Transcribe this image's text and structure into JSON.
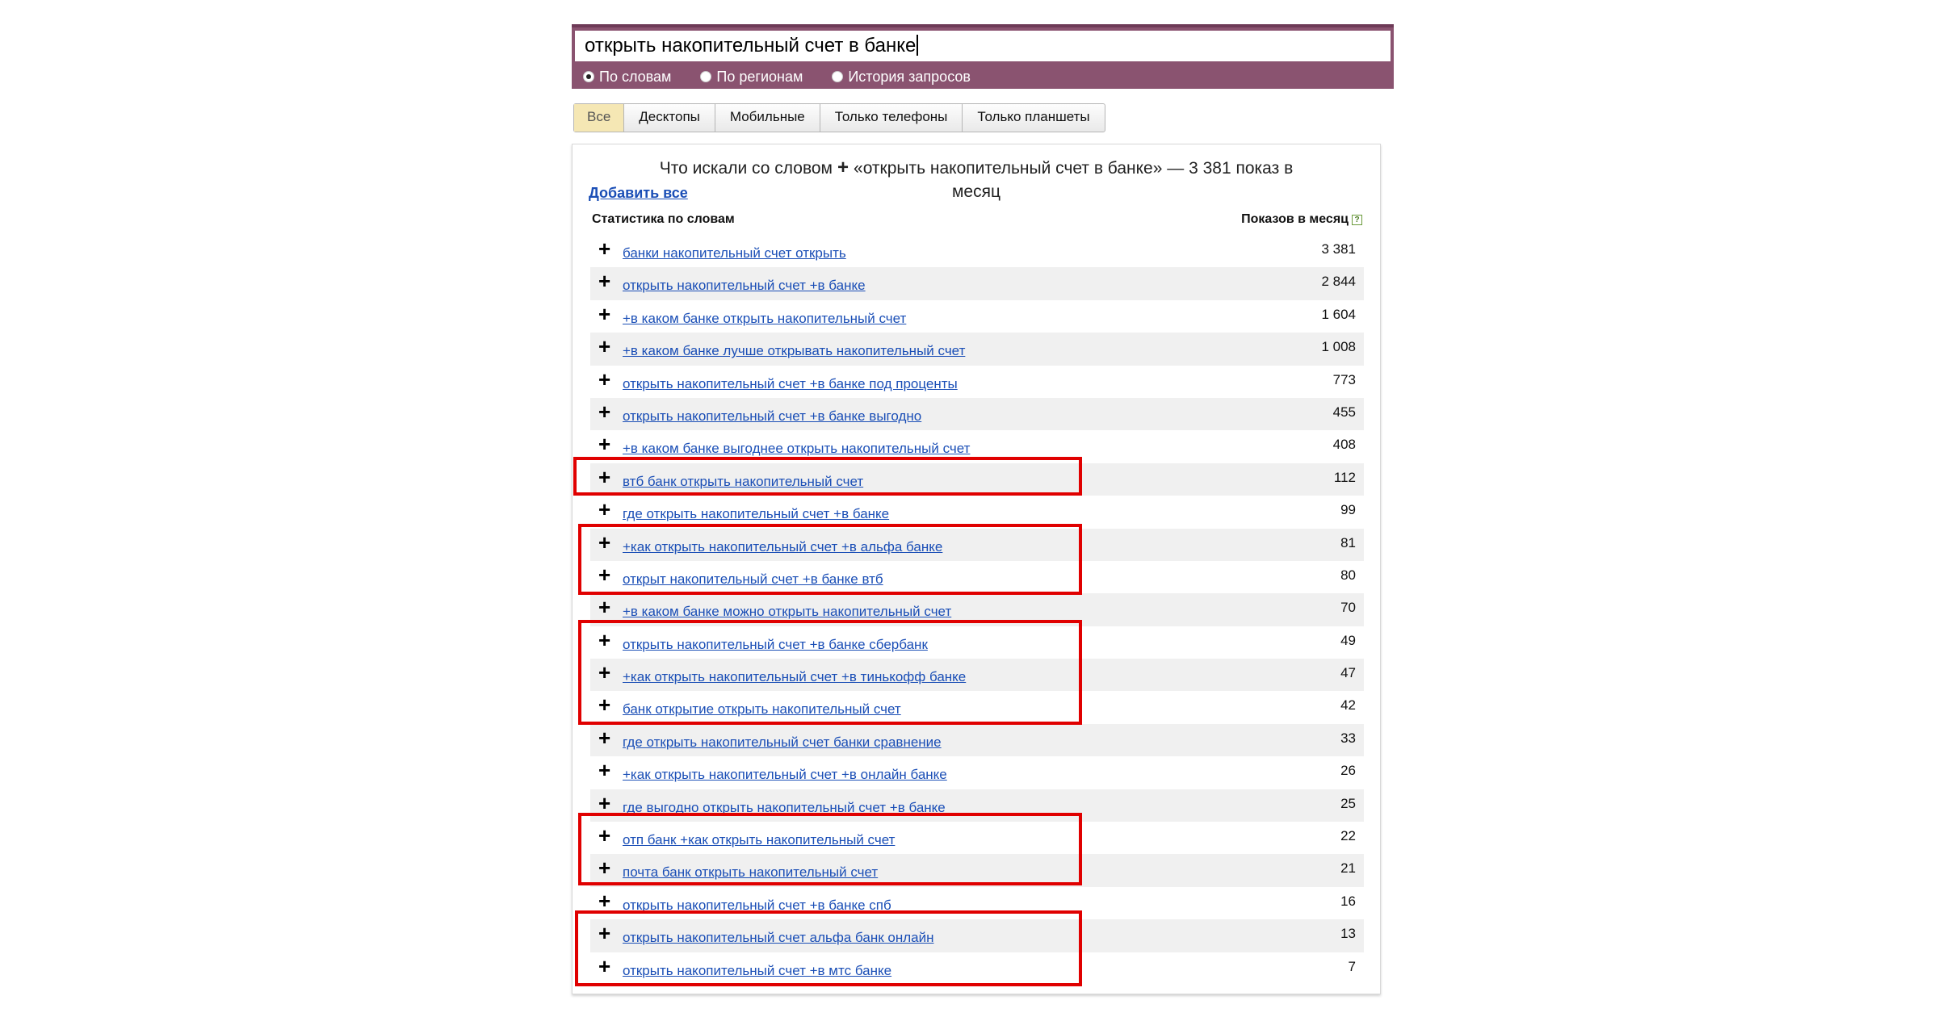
{
  "search": {
    "query": "открыть накопительный счет в банке",
    "modes": [
      {
        "label": "По словам",
        "checked": true
      },
      {
        "label": "По регионам",
        "checked": false
      },
      {
        "label": "История запросов",
        "checked": false
      }
    ]
  },
  "tabs": [
    {
      "label": "Все",
      "active": true
    },
    {
      "label": "Десктопы",
      "active": false
    },
    {
      "label": "Мобильные",
      "active": false
    },
    {
      "label": "Только телефоны",
      "active": false
    },
    {
      "label": "Только планшеты",
      "active": false
    }
  ],
  "stats": {
    "heading_prefix": "Что искали со словом",
    "heading_plus": "+",
    "heading_line1": "«открыть накопительный счет в банке» — 3 381 показ в",
    "heading_line2": "месяц",
    "add_all": "Добавить все",
    "col_words": "Статистика по словам",
    "col_shows": "Показов в месяц",
    "help_glyph": "?",
    "rows": [
      {
        "phrase": "банки накопительный счет открыть",
        "count": "3 381"
      },
      {
        "phrase": "открыть накопительный счет +в банке",
        "count": "2 844"
      },
      {
        "phrase": "+в каком банке открыть накопительный счет",
        "count": "1 604"
      },
      {
        "phrase": "+в каком банке лучше открывать накопительный счет",
        "count": "1 008"
      },
      {
        "phrase": "открыть накопительный счет +в банке под проценты",
        "count": "773"
      },
      {
        "phrase": "открыть накопительный счет +в банке выгодно",
        "count": "455"
      },
      {
        "phrase": "+в каком банке выгоднее открыть накопительный счет",
        "count": "408"
      },
      {
        "phrase": "втб банк открыть накопительный счет",
        "count": "112"
      },
      {
        "phrase": "где открыть накопительный счет +в банке",
        "count": "99"
      },
      {
        "phrase": "+как открыть накопительный счет +в альфа банке",
        "count": "81"
      },
      {
        "phrase": "открыт накопительный счет +в банке втб",
        "count": "80"
      },
      {
        "phrase": "+в каком банке можно открыть накопительный счет",
        "count": "70"
      },
      {
        "phrase": "открыть накопительный счет +в банке сбербанк",
        "count": "49"
      },
      {
        "phrase": "+как открыть накопительный счет +в тинькофф банке",
        "count": "47"
      },
      {
        "phrase": "банк открытие открыть накопительный счет",
        "count": "42"
      },
      {
        "phrase": "где открыть накопительный счет банки сравнение",
        "count": "33"
      },
      {
        "phrase": "+как открыть накопительный счет +в онлайн банке",
        "count": "26"
      },
      {
        "phrase": "где выгодно открыть накопительный счет +в банке",
        "count": "25"
      },
      {
        "phrase": "отп банк +как открыть накопительный счет",
        "count": "22"
      },
      {
        "phrase": "почта банк открыть накопительный счет",
        "count": "21"
      },
      {
        "phrase": "открыть накопительный счет +в банке спб",
        "count": "16"
      },
      {
        "phrase": "открыть накопительный счет альфа банк онлайн",
        "count": "13"
      },
      {
        "phrase": "открыть накопительный счет +в мтс банке",
        "count": "7"
      }
    ]
  },
  "colors": {
    "accent_bar": "#8a5370",
    "link": "#1a4eb6",
    "highlight": "#e00000",
    "active_tab": "#f5e7b4"
  }
}
